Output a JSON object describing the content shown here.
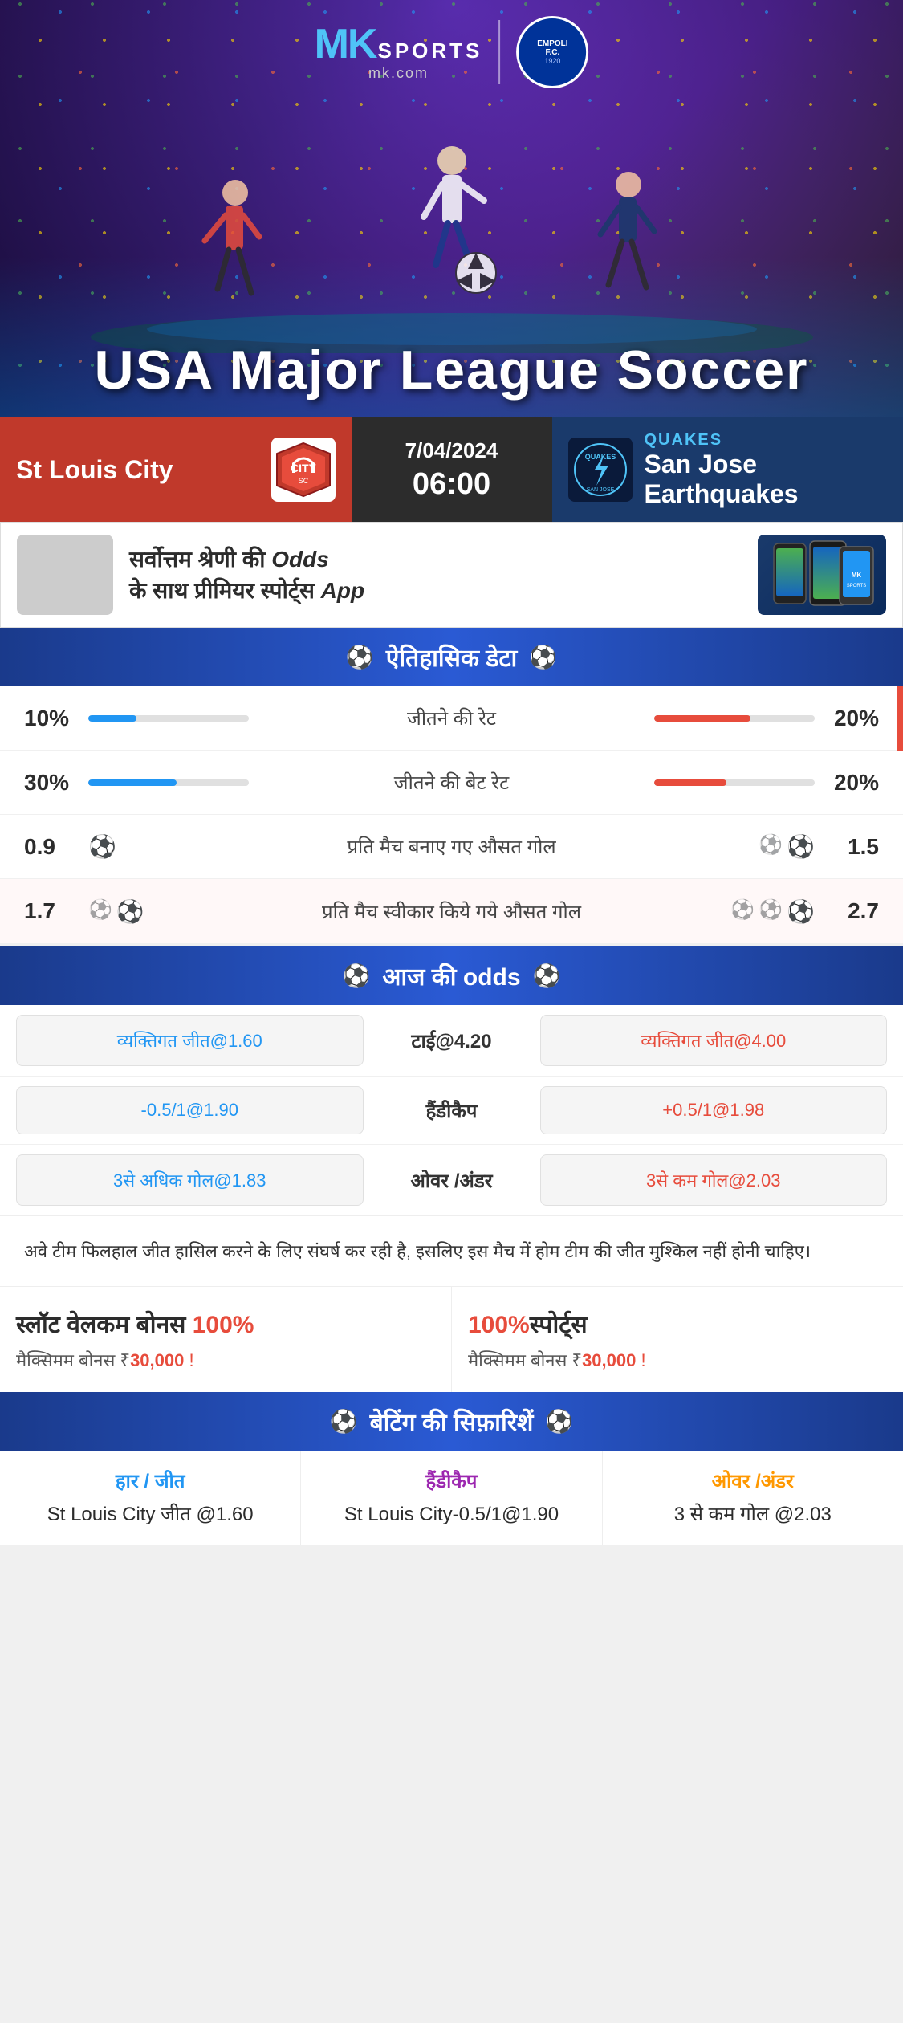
{
  "brand": {
    "mk_prefix": "MK",
    "mk_suffix": "SPORTS",
    "mk_domain": "mk.com",
    "empoli": "EMPOLI F.C.",
    "empoli_year": "1920"
  },
  "hero": {
    "title": "USA Major League Soccer"
  },
  "match": {
    "team_left": "St Louis City",
    "team_right": "San Jose Earthquakes",
    "team_right_abbr": "QUAKES",
    "date": "7/04/2024",
    "time": "06:00"
  },
  "promo": {
    "text_line1": "सर्वोत्तम श्रेणी की ",
    "text_odds": "Odds",
    "text_line2": "के साथ प्रीमियर स्पोर्ट्स ",
    "text_app": "App"
  },
  "historical": {
    "section_title": "ऐतिहासिक डेटा",
    "rows": [
      {
        "left_val": "10%",
        "label": "जीतने की रेट",
        "right_val": "20%",
        "left_bar_pct": 30,
        "right_bar_pct": 60,
        "type": "bar"
      },
      {
        "left_val": "30%",
        "label": "जीतने की बेट रेट",
        "right_val": "20%",
        "left_bar_pct": 55,
        "right_bar_pct": 45,
        "type": "bar"
      },
      {
        "left_val": "0.9",
        "label": "प्रति मैच बनाए गए औसत गोल",
        "right_val": "1.5",
        "left_icons": 1,
        "right_icons": 2,
        "type": "icon"
      },
      {
        "left_val": "1.7",
        "label": "प्रति मैच स्वीकार किये गये औसत गोल",
        "right_val": "2.7",
        "left_icons": 2,
        "right_icons": 3,
        "type": "icon"
      }
    ]
  },
  "odds": {
    "section_title": "आज की odds",
    "rows": [
      {
        "left": "व्यक्तिगत जीत@1.60",
        "center": "टाई@4.20",
        "right": "व्यक्तिगत जीत@4.00",
        "left_color": "blue",
        "right_color": "red"
      },
      {
        "left": "-0.5/1@1.90",
        "center": "हैंडीकैप",
        "right": "+0.5/1@1.98",
        "left_color": "blue",
        "right_color": "red"
      },
      {
        "left": "3से अधिक गोल@1.83",
        "center": "ओवर /अंडर",
        "right": "3से कम गोल@2.03",
        "left_color": "blue",
        "right_color": "red"
      }
    ]
  },
  "analysis": {
    "text": "अवे टीम फिलहाल जीत हासिल करने के लिए संघर्ष कर रही है, इसलिए इस मैच में होम टीम की जीत मुश्किल नहीं होनी चाहिए।"
  },
  "bonus": {
    "cards": [
      {
        "title_prefix": "स्लॉट वेलकम बोनस ",
        "title_pct": "100%",
        "subtitle_prefix": "मैक्सिमम बोनस ₹",
        "subtitle_amt": "30,000",
        "subtitle_suffix": " !"
      },
      {
        "title_prefix": "",
        "title_pct": "100%",
        "title_suffix": "स्पोर्ट्स",
        "subtitle_prefix": "मैक्सिमम बोनस  ₹",
        "subtitle_amt": "30,000",
        "subtitle_suffix": " !"
      }
    ]
  },
  "recommendations": {
    "section_title": "बेटिंग की सिफ़ारिशें",
    "cols": [
      {
        "type": "हार / जीत",
        "type_color": "blue",
        "value": "St Louis City जीत @1.60"
      },
      {
        "type": "हैंडीकैप",
        "type_color": "purple",
        "value": "St Louis City-0.5/1@1.90"
      },
      {
        "type": "ओवर /अंडर",
        "type_color": "orange",
        "value": "3 से कम गोल @2.03"
      }
    ]
  }
}
